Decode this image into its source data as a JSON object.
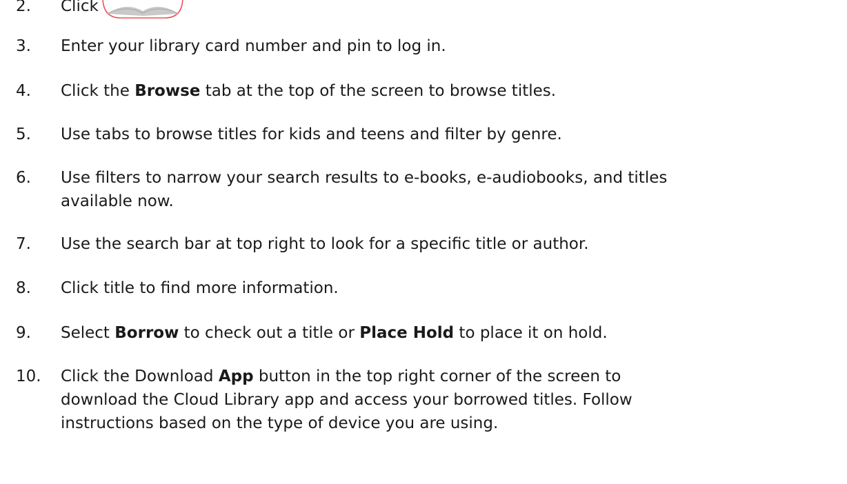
{
  "steps": [
    {
      "num": "2.",
      "parts": [
        "Click"
      ],
      "icon": "cloud-library-book-icon"
    },
    {
      "num": "3.",
      "parts": [
        "Enter your library card number and pin to log in."
      ]
    },
    {
      "num": "4.",
      "parts": [
        "Click the ",
        "Browse",
        " tab at the top of the screen to browse titles."
      ]
    },
    {
      "num": "5.",
      "parts": [
        "Use tabs to browse titles for kids and teens and filter by genre."
      ]
    },
    {
      "num": "6.",
      "parts": [
        "Use filters to narrow your search results to e-books, e-audiobooks, and titles",
        "available now."
      ]
    },
    {
      "num": "7.",
      "parts": [
        "Use the search bar at top right to look for a specific title or author."
      ]
    },
    {
      "num": "8.",
      "parts": [
        "Click title to find more information."
      ]
    },
    {
      "num": "9.",
      "parts": [
        "Select ",
        "Borrow",
        " to check out a title or ",
        "Place Hold",
        " to place it on hold."
      ]
    },
    {
      "num": "10.",
      "parts": [
        "Click the Download ",
        "App",
        " button in the top right corner of the screen to",
        "download the Cloud Library app and access your borrowed titles. Follow",
        "instructions based on the type of device you are using."
      ]
    }
  ],
  "icon_colors": {
    "border": "#e8535a",
    "book": "#c9c9c9"
  }
}
